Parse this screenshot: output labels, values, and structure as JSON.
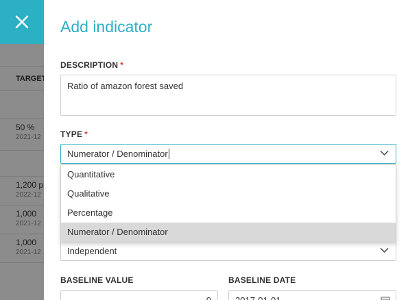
{
  "background": {
    "table_header": "TARGET",
    "rows": [
      {
        "value": "50 %",
        "date": "2021-12"
      },
      {
        "value": "1,200 p",
        "date": "2022-12"
      },
      {
        "value": "1,000",
        "date": "2021-12"
      },
      {
        "value": "1,000",
        "date": "2021-12"
      }
    ]
  },
  "close_button": {
    "icon": "close-icon"
  },
  "modal": {
    "title": "Add indicator",
    "description": {
      "label": "DESCRIPTION",
      "required_mark": "*",
      "value": "Ratio of amazon forest saved"
    },
    "type": {
      "label": "TYPE",
      "required_mark": "*",
      "value": "Numerator / Denominator",
      "options": [
        "Quantitative",
        "Qualitative",
        "Percentage",
        "Numerator / Denominator"
      ],
      "selected_index": 3
    },
    "hidden_select": {
      "value": "Independent"
    },
    "baseline_value": {
      "label": "BASELINE VALUE",
      "value": "0"
    },
    "baseline_date": {
      "label": "BASELINE DATE",
      "value": "2017-01-01"
    }
  },
  "colors": {
    "accent": "#2bb0c4",
    "required": "#e53935",
    "selected_option_bg": "#d9d9d9"
  }
}
